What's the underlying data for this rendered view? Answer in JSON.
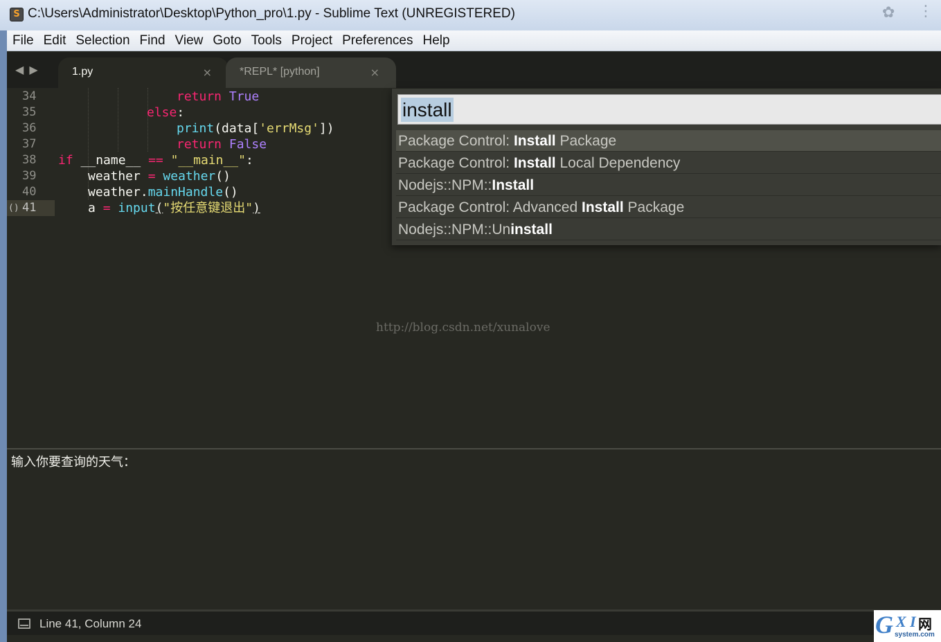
{
  "window": {
    "title": "C:\\Users\\Administrator\\Desktop\\Python_pro\\1.py - Sublime Text (UNREGISTERED)",
    "app_icon_letter": "S"
  },
  "menu": [
    "File",
    "Edit",
    "Selection",
    "Find",
    "View",
    "Goto",
    "Tools",
    "Project",
    "Preferences",
    "Help"
  ],
  "tabs": [
    {
      "label": "1.py",
      "active": true,
      "close": "×"
    },
    {
      "label": "*REPL* [python]",
      "active": false,
      "close": "×"
    }
  ],
  "editor": {
    "line_numbers": [
      "34",
      "35",
      "36",
      "37",
      "38",
      "39",
      "40",
      "41"
    ],
    "current_line": "41",
    "bracket_marker": "()",
    "lines": [
      {
        "t1": "return",
        "t2": " ",
        "t3": "True"
      },
      {
        "t1": "else",
        "t2": ":"
      },
      {
        "t1": "print",
        "t2": "(data[",
        "t3": "'errMsg'",
        "t4": "])"
      },
      {
        "t1": "return",
        "t2": " ",
        "t3": "False"
      },
      {
        "t1": "if",
        "t2": " __name__ ",
        "t3": "==",
        "t4": " ",
        "t5": "\"__main__\"",
        "t6": ":"
      },
      {
        "t1": "weather ",
        "t2": "=",
        "t3": " ",
        "t4": "weather",
        "t5": "()"
      },
      {
        "t1": "weather.",
        "t2": "mainHandle",
        "t3": "()"
      },
      {
        "t1": "a ",
        "t2": "=",
        "t3": " ",
        "t4": "input",
        "t5": "(",
        "t6": "\"按任意键退出\"",
        "t7": ")"
      }
    ]
  },
  "palette": {
    "query": "install",
    "items": [
      {
        "pre": "Package Control: ",
        "match": "Install",
        "post": " Package"
      },
      {
        "pre": "Package Control: ",
        "match": "Install",
        "post": " Local Dependency"
      },
      {
        "pre": "Nodejs::NPM::",
        "match": "Install",
        "post": ""
      },
      {
        "pre": "Package Control: Advanced ",
        "match": "Install",
        "post": " Package"
      },
      {
        "pre": "Nodejs::NPM::Un",
        "match": "install",
        "post": ""
      }
    ]
  },
  "watermark": "http://blog.csdn.net/xunalove",
  "output": {
    "text": "输入你要查询的天气："
  },
  "status": {
    "text": "Line 41, Column 24"
  },
  "logo": {
    "g": "G",
    "xi": "X I",
    "net": "网",
    "sub": "system.com"
  }
}
